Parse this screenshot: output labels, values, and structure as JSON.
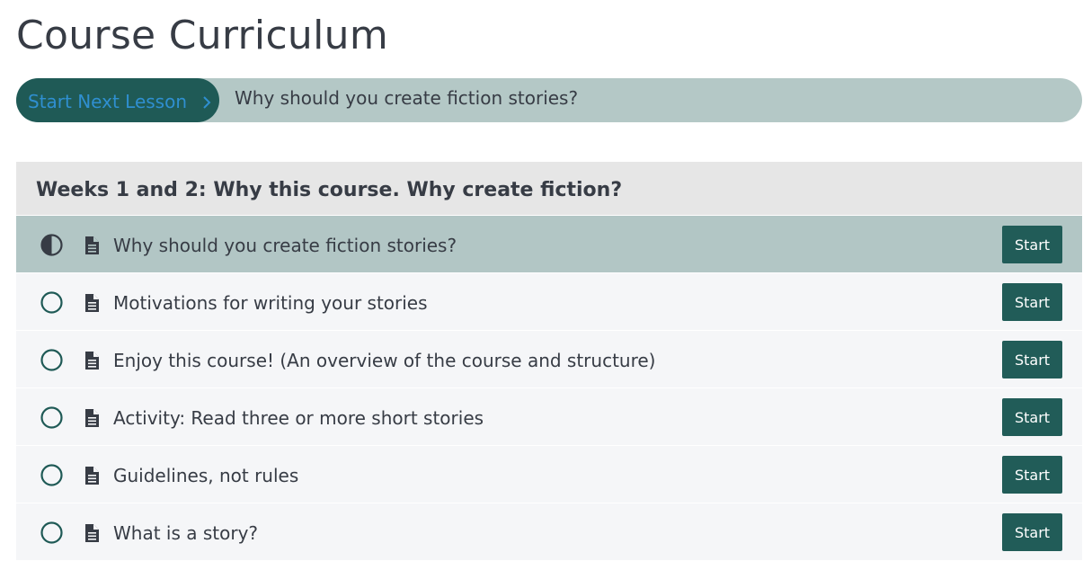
{
  "page": {
    "title": "Course Curriculum"
  },
  "next_lesson": {
    "button_label": "Start Next Lesson",
    "lesson_title": "Why should you create fiction stories?"
  },
  "section": {
    "title": "Weeks 1 and 2: Why this course. Why create fiction?",
    "lessons": [
      {
        "title": "Why should you create fiction stories?",
        "status": "in-progress",
        "button": "Start",
        "icon": "document-icon"
      },
      {
        "title": "Motivations for writing your stories",
        "status": "not-started",
        "button": "Start",
        "icon": "document-icon"
      },
      {
        "title": "Enjoy this course! (An overview of the course and structure)",
        "status": "not-started",
        "button": "Start",
        "icon": "document-icon"
      },
      {
        "title": "Activity: Read three or more short stories",
        "status": "not-started",
        "button": "Start",
        "icon": "document-icon"
      },
      {
        "title": "Guidelines, not rules",
        "status": "not-started",
        "button": "Start",
        "icon": "document-icon"
      },
      {
        "title": "What is a story?",
        "status": "not-started",
        "button": "Start",
        "icon": "document-icon"
      }
    ]
  },
  "colors": {
    "accent": "#1f5a56",
    "current_row": "#b2c6c5",
    "bar": "#b4c8c6",
    "link_text": "#2f8fd0"
  }
}
